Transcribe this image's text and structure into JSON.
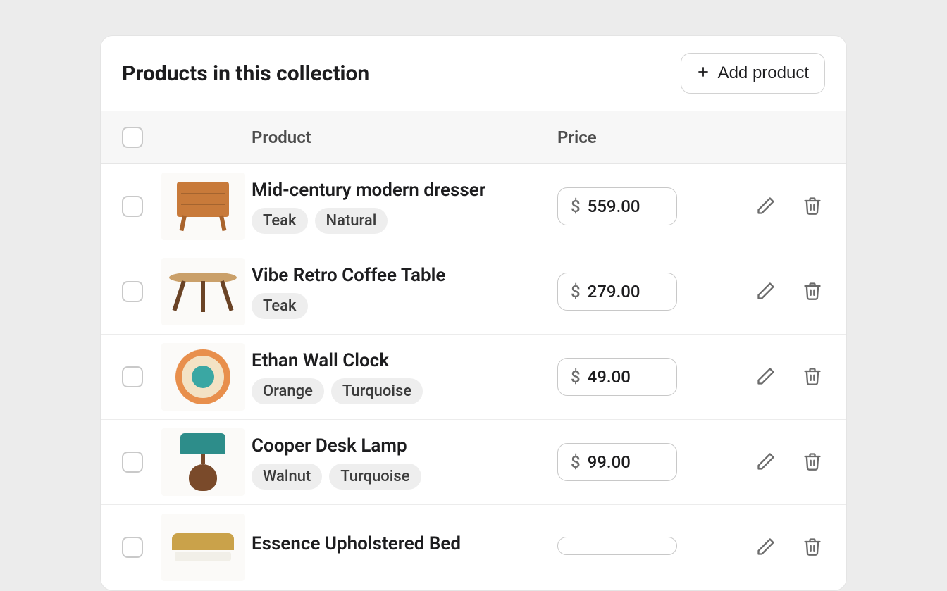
{
  "header": {
    "title": "Products in this collection",
    "add_label": "Add product"
  },
  "currency_symbol": "$",
  "columns": {
    "product": "Product",
    "price": "Price"
  },
  "products": [
    {
      "name": "Mid-century modern dresser",
      "tags": [
        "Teak",
        "Natural"
      ],
      "price": "559.00",
      "thumb": "dresser"
    },
    {
      "name": "Vibe Retro Coffee Table",
      "tags": [
        "Teak"
      ],
      "price": "279.00",
      "thumb": "table"
    },
    {
      "name": "Ethan Wall Clock",
      "tags": [
        "Orange",
        "Turquoise"
      ],
      "price": "49.00",
      "thumb": "clock"
    },
    {
      "name": "Cooper Desk Lamp",
      "tags": [
        "Walnut",
        "Turquoise"
      ],
      "price": "99.00",
      "thumb": "lamp"
    },
    {
      "name": "Essence Upholstered Bed",
      "tags": [],
      "price": "",
      "thumb": "bed"
    }
  ]
}
